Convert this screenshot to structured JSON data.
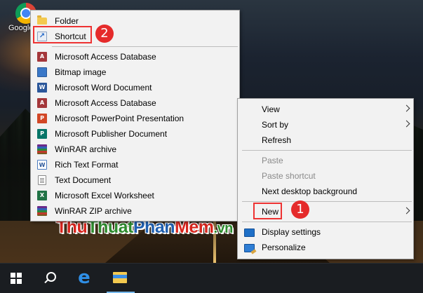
{
  "desktop": {
    "icon_label": "Google Chrome"
  },
  "new_submenu": {
    "items": [
      {
        "label": "Folder",
        "icon": "folder-icon"
      },
      {
        "label": "Shortcut",
        "icon": "shortcut-icon"
      },
      {
        "label": "Microsoft Access Database",
        "icon": "access-icon"
      },
      {
        "label": "Bitmap image",
        "icon": "bitmap-icon"
      },
      {
        "label": "Microsoft Word Document",
        "icon": "word-icon"
      },
      {
        "label": "Microsoft Access Database",
        "icon": "access-icon"
      },
      {
        "label": "Microsoft PowerPoint Presentation",
        "icon": "powerpoint-icon"
      },
      {
        "label": "Microsoft Publisher Document",
        "icon": "publisher-icon"
      },
      {
        "label": "WinRAR archive",
        "icon": "winrar-icon"
      },
      {
        "label": "Rich Text Format",
        "icon": "rtf-icon"
      },
      {
        "label": "Text Document",
        "icon": "text-document-icon"
      },
      {
        "label": "Microsoft Excel Worksheet",
        "icon": "excel-icon"
      },
      {
        "label": "WinRAR ZIP archive",
        "icon": "winrar-zip-icon"
      }
    ],
    "icon_glyphs": {
      "shortcut": "↗",
      "access": "A",
      "word": "W",
      "powerpoint": "P",
      "publisher": "P",
      "rtf": "W"
    }
  },
  "context_menu": {
    "items": [
      {
        "label": "View",
        "has_submenu": true
      },
      {
        "label": "Sort by",
        "has_submenu": true
      },
      {
        "label": "Refresh"
      },
      {
        "label": "Paste",
        "disabled": true
      },
      {
        "label": "Paste shortcut",
        "disabled": true
      },
      {
        "label": "Next desktop background"
      },
      {
        "label": "New",
        "has_submenu": true
      },
      {
        "label": "Display settings",
        "icon": "display-settings-icon"
      },
      {
        "label": "Personalize",
        "icon": "personalize-icon"
      }
    ]
  },
  "callouts": {
    "step1": "1",
    "step2": "2",
    "color": "#e52b2b"
  },
  "watermark": {
    "part1": "Thu",
    "part2": "Thuat",
    "part3": "Phan",
    "part4": "Mem",
    "part5": ".vn"
  },
  "taskbar": {
    "items": [
      "start-icon",
      "search-icon",
      "edge-icon",
      "file-explorer-icon"
    ],
    "edge_glyph": "e"
  }
}
